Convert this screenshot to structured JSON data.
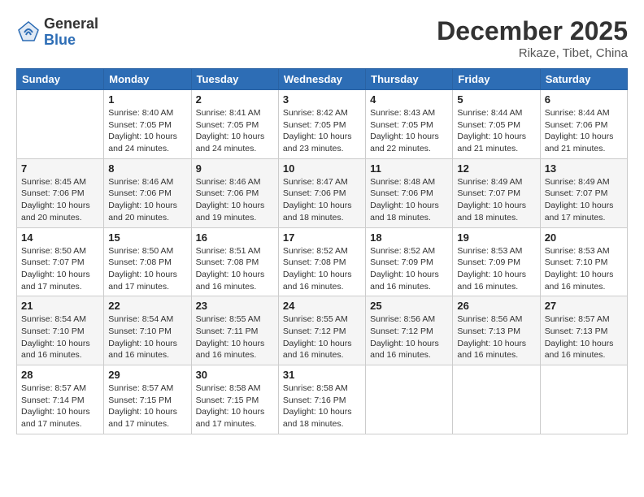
{
  "logo": {
    "general": "General",
    "blue": "Blue"
  },
  "title": {
    "month": "December 2025",
    "location": "Rikaze, Tibet, China"
  },
  "weekdays": [
    "Sunday",
    "Monday",
    "Tuesday",
    "Wednesday",
    "Thursday",
    "Friday",
    "Saturday"
  ],
  "weeks": [
    [
      {
        "day": "",
        "sunrise": "",
        "sunset": "",
        "daylight": ""
      },
      {
        "day": "1",
        "sunrise": "Sunrise: 8:40 AM",
        "sunset": "Sunset: 7:05 PM",
        "daylight": "Daylight: 10 hours and 24 minutes."
      },
      {
        "day": "2",
        "sunrise": "Sunrise: 8:41 AM",
        "sunset": "Sunset: 7:05 PM",
        "daylight": "Daylight: 10 hours and 24 minutes."
      },
      {
        "day": "3",
        "sunrise": "Sunrise: 8:42 AM",
        "sunset": "Sunset: 7:05 PM",
        "daylight": "Daylight: 10 hours and 23 minutes."
      },
      {
        "day": "4",
        "sunrise": "Sunrise: 8:43 AM",
        "sunset": "Sunset: 7:05 PM",
        "daylight": "Daylight: 10 hours and 22 minutes."
      },
      {
        "day": "5",
        "sunrise": "Sunrise: 8:44 AM",
        "sunset": "Sunset: 7:05 PM",
        "daylight": "Daylight: 10 hours and 21 minutes."
      },
      {
        "day": "6",
        "sunrise": "Sunrise: 8:44 AM",
        "sunset": "Sunset: 7:06 PM",
        "daylight": "Daylight: 10 hours and 21 minutes."
      }
    ],
    [
      {
        "day": "7",
        "sunrise": "Sunrise: 8:45 AM",
        "sunset": "Sunset: 7:06 PM",
        "daylight": "Daylight: 10 hours and 20 minutes."
      },
      {
        "day": "8",
        "sunrise": "Sunrise: 8:46 AM",
        "sunset": "Sunset: 7:06 PM",
        "daylight": "Daylight: 10 hours and 20 minutes."
      },
      {
        "day": "9",
        "sunrise": "Sunrise: 8:46 AM",
        "sunset": "Sunset: 7:06 PM",
        "daylight": "Daylight: 10 hours and 19 minutes."
      },
      {
        "day": "10",
        "sunrise": "Sunrise: 8:47 AM",
        "sunset": "Sunset: 7:06 PM",
        "daylight": "Daylight: 10 hours and 18 minutes."
      },
      {
        "day": "11",
        "sunrise": "Sunrise: 8:48 AM",
        "sunset": "Sunset: 7:06 PM",
        "daylight": "Daylight: 10 hours and 18 minutes."
      },
      {
        "day": "12",
        "sunrise": "Sunrise: 8:49 AM",
        "sunset": "Sunset: 7:07 PM",
        "daylight": "Daylight: 10 hours and 18 minutes."
      },
      {
        "day": "13",
        "sunrise": "Sunrise: 8:49 AM",
        "sunset": "Sunset: 7:07 PM",
        "daylight": "Daylight: 10 hours and 17 minutes."
      }
    ],
    [
      {
        "day": "14",
        "sunrise": "Sunrise: 8:50 AM",
        "sunset": "Sunset: 7:07 PM",
        "daylight": "Daylight: 10 hours and 17 minutes."
      },
      {
        "day": "15",
        "sunrise": "Sunrise: 8:50 AM",
        "sunset": "Sunset: 7:08 PM",
        "daylight": "Daylight: 10 hours and 17 minutes."
      },
      {
        "day": "16",
        "sunrise": "Sunrise: 8:51 AM",
        "sunset": "Sunset: 7:08 PM",
        "daylight": "Daylight: 10 hours and 16 minutes."
      },
      {
        "day": "17",
        "sunrise": "Sunrise: 8:52 AM",
        "sunset": "Sunset: 7:08 PM",
        "daylight": "Daylight: 10 hours and 16 minutes."
      },
      {
        "day": "18",
        "sunrise": "Sunrise: 8:52 AM",
        "sunset": "Sunset: 7:09 PM",
        "daylight": "Daylight: 10 hours and 16 minutes."
      },
      {
        "day": "19",
        "sunrise": "Sunrise: 8:53 AM",
        "sunset": "Sunset: 7:09 PM",
        "daylight": "Daylight: 10 hours and 16 minutes."
      },
      {
        "day": "20",
        "sunrise": "Sunrise: 8:53 AM",
        "sunset": "Sunset: 7:10 PM",
        "daylight": "Daylight: 10 hours and 16 minutes."
      }
    ],
    [
      {
        "day": "21",
        "sunrise": "Sunrise: 8:54 AM",
        "sunset": "Sunset: 7:10 PM",
        "daylight": "Daylight: 10 hours and 16 minutes."
      },
      {
        "day": "22",
        "sunrise": "Sunrise: 8:54 AM",
        "sunset": "Sunset: 7:10 PM",
        "daylight": "Daylight: 10 hours and 16 minutes."
      },
      {
        "day": "23",
        "sunrise": "Sunrise: 8:55 AM",
        "sunset": "Sunset: 7:11 PM",
        "daylight": "Daylight: 10 hours and 16 minutes."
      },
      {
        "day": "24",
        "sunrise": "Sunrise: 8:55 AM",
        "sunset": "Sunset: 7:12 PM",
        "daylight": "Daylight: 10 hours and 16 minutes."
      },
      {
        "day": "25",
        "sunrise": "Sunrise: 8:56 AM",
        "sunset": "Sunset: 7:12 PM",
        "daylight": "Daylight: 10 hours and 16 minutes."
      },
      {
        "day": "26",
        "sunrise": "Sunrise: 8:56 AM",
        "sunset": "Sunset: 7:13 PM",
        "daylight": "Daylight: 10 hours and 16 minutes."
      },
      {
        "day": "27",
        "sunrise": "Sunrise: 8:57 AM",
        "sunset": "Sunset: 7:13 PM",
        "daylight": "Daylight: 10 hours and 16 minutes."
      }
    ],
    [
      {
        "day": "28",
        "sunrise": "Sunrise: 8:57 AM",
        "sunset": "Sunset: 7:14 PM",
        "daylight": "Daylight: 10 hours and 17 minutes."
      },
      {
        "day": "29",
        "sunrise": "Sunrise: 8:57 AM",
        "sunset": "Sunset: 7:15 PM",
        "daylight": "Daylight: 10 hours and 17 minutes."
      },
      {
        "day": "30",
        "sunrise": "Sunrise: 8:58 AM",
        "sunset": "Sunset: 7:15 PM",
        "daylight": "Daylight: 10 hours and 17 minutes."
      },
      {
        "day": "31",
        "sunrise": "Sunrise: 8:58 AM",
        "sunset": "Sunset: 7:16 PM",
        "daylight": "Daylight: 10 hours and 18 minutes."
      },
      {
        "day": "",
        "sunrise": "",
        "sunset": "",
        "daylight": ""
      },
      {
        "day": "",
        "sunrise": "",
        "sunset": "",
        "daylight": ""
      },
      {
        "day": "",
        "sunrise": "",
        "sunset": "",
        "daylight": ""
      }
    ]
  ]
}
